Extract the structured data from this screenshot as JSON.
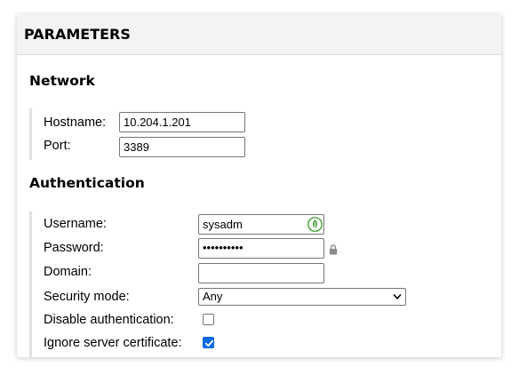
{
  "panel": {
    "title": "PARAMETERS"
  },
  "network": {
    "title": "Network",
    "hostname": {
      "label": "Hostname:",
      "value": "10.204.1.201"
    },
    "port": {
      "label": "Port:",
      "value": "3389"
    }
  },
  "authentication": {
    "title": "Authentication",
    "username": {
      "label": "Username:",
      "value": "sysadm"
    },
    "password": {
      "label": "Password:",
      "value": "••••••••••"
    },
    "domain": {
      "label": "Domain:",
      "value": ""
    },
    "security_mode": {
      "label": "Security mode:",
      "value": "Any"
    },
    "disable_auth": {
      "label": "Disable authentication:",
      "checked": false
    },
    "ignore_cert": {
      "label": "Ignore server certificate:",
      "checked": true
    }
  },
  "colors": {
    "checkbox_accent": "#0b69e3",
    "password_manager_icon": "#3a9a2a"
  },
  "icons": [
    "password-manager-icon",
    "lock-icon",
    "chevron-down-icon",
    "checkmark-icon"
  ]
}
